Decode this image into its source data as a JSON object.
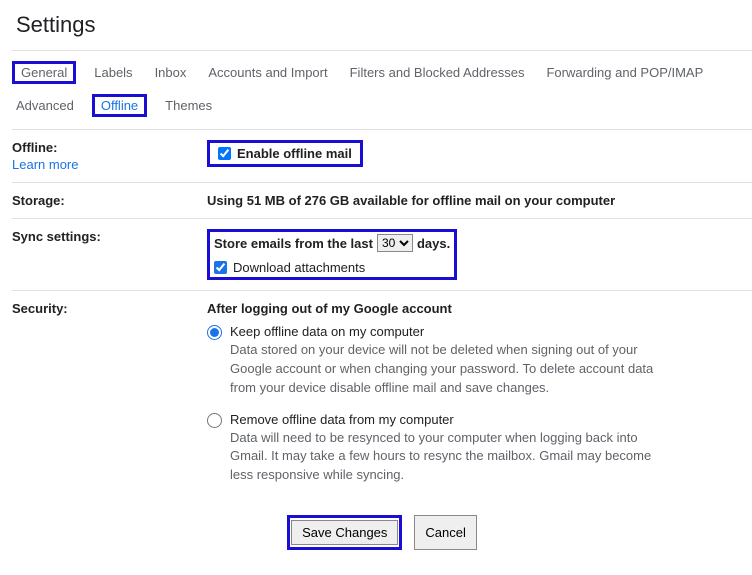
{
  "title": "Settings",
  "tabs_row1": [
    "General",
    "Labels",
    "Inbox",
    "Accounts and Import",
    "Filters and Blocked Addresses",
    "Forwarding and POP/IMAP"
  ],
  "tabs_row2": [
    "Advanced",
    "Offline",
    "Themes"
  ],
  "highlighted_tabs": [
    "General",
    "Offline"
  ],
  "active_tab": "Offline",
  "offline": {
    "label": "Offline:",
    "learn_more": "Learn more",
    "enable_label": "Enable offline mail",
    "enable_checked": true
  },
  "storage": {
    "label": "Storage:",
    "text": "Using 51 MB of 276 GB available for offline mail on your computer"
  },
  "sync": {
    "label": "Sync settings:",
    "store_prefix": "Store emails from the last",
    "store_suffix": "days.",
    "days_value": "30",
    "download_label": "Download attachments",
    "download_checked": true
  },
  "security": {
    "label": "Security:",
    "heading": "After logging out of my Google account",
    "options": [
      {
        "label": "Keep offline data on my computer",
        "desc": "Data stored on your device will not be deleted when signing out of your Google account or when changing your password. To delete account data from your device disable offline mail and save changes.",
        "checked": true
      },
      {
        "label": "Remove offline data from my computer",
        "desc": "Data will need to be resynced to your computer when logging back into Gmail. It may take a few hours to resync the mailbox. Gmail may become less responsive while syncing.",
        "checked": false
      }
    ]
  },
  "buttons": {
    "save": "Save Changes",
    "cancel": "Cancel"
  }
}
